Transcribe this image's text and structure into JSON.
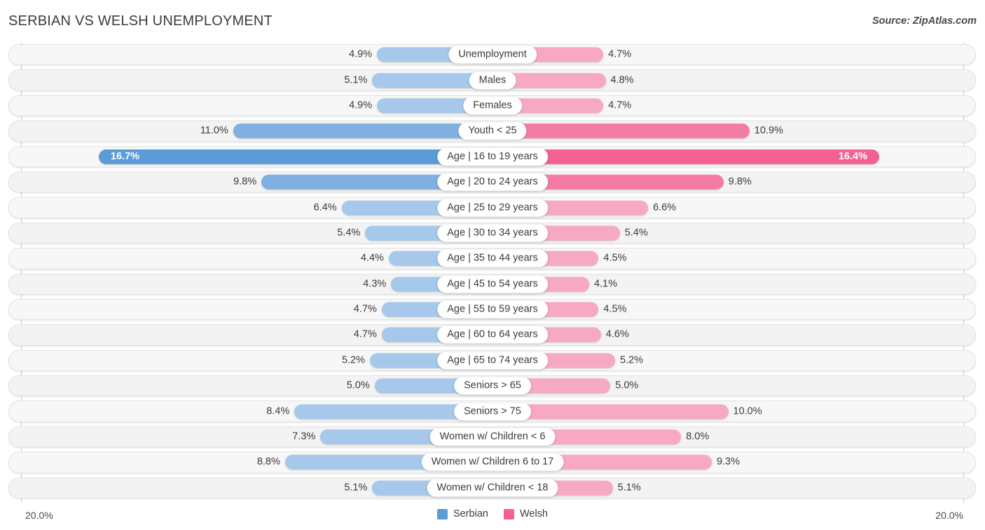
{
  "header": {
    "title": "SERBIAN VS WELSH UNEMPLOYMENT",
    "source": "Source: ZipAtlas.com"
  },
  "footer": {
    "axis_min_left": "20.0%",
    "axis_min_right": "20.0%",
    "legend": [
      {
        "label": "Serbian",
        "color": "#5b9bd8"
      },
      {
        "label": "Welsh",
        "color": "#f2618f"
      }
    ]
  },
  "colors": {
    "serbian_light": "#a6c8ea",
    "serbian_mid": "#7fb0e0",
    "serbian_dark": "#5b9bd8",
    "welsh_light": "#f7a8c4",
    "welsh_mid": "#f47ba6",
    "welsh_dark": "#f2618f",
    "track": "#f7f7f7",
    "axis": "#c9c9cd"
  },
  "chart_data": {
    "type": "bar",
    "orientation": "horizontal-diverging",
    "title": "SERBIAN VS WELSH UNEMPLOYMENT",
    "xlabel": "",
    "ylabel": "",
    "axis_max": 20.0,
    "axis_unit": "%",
    "grid": false,
    "legend_position": "bottom-center",
    "categories": [
      "Unemployment",
      "Males",
      "Females",
      "Youth < 25",
      "Age | 16 to 19 years",
      "Age | 20 to 24 years",
      "Age | 25 to 29 years",
      "Age | 30 to 34 years",
      "Age | 35 to 44 years",
      "Age | 45 to 54 years",
      "Age | 55 to 59 years",
      "Age | 60 to 64 years",
      "Age | 65 to 74 years",
      "Seniors > 65",
      "Seniors > 75",
      "Women w/ Children < 6",
      "Women w/ Children 6 to 17",
      "Women w/ Children < 18"
    ],
    "series": [
      {
        "name": "Serbian",
        "side": "left",
        "color": "#a6c8ea",
        "values": [
          4.9,
          5.1,
          4.9,
          11.0,
          16.7,
          9.8,
          6.4,
          5.4,
          4.4,
          4.3,
          4.7,
          4.7,
          5.2,
          5.0,
          8.4,
          7.3,
          8.8,
          5.1
        ],
        "labels": [
          "4.9%",
          "5.1%",
          "4.9%",
          "11.0%",
          "16.7%",
          "9.8%",
          "6.4%",
          "5.4%",
          "4.4%",
          "4.3%",
          "4.7%",
          "4.7%",
          "5.2%",
          "5.0%",
          "8.4%",
          "7.3%",
          "8.8%",
          "5.1%"
        ]
      },
      {
        "name": "Welsh",
        "side": "right",
        "color": "#f7a8c4",
        "values": [
          4.7,
          4.8,
          4.7,
          10.9,
          16.4,
          9.8,
          6.6,
          5.4,
          4.5,
          4.1,
          4.5,
          4.6,
          5.2,
          5.0,
          10.0,
          8.0,
          9.3,
          5.1
        ],
        "labels": [
          "4.7%",
          "4.8%",
          "4.7%",
          "10.9%",
          "16.4%",
          "9.8%",
          "6.6%",
          "5.4%",
          "4.5%",
          "4.1%",
          "4.5%",
          "4.6%",
          "5.2%",
          "5.0%",
          "10.0%",
          "8.0%",
          "9.3%",
          "5.1%"
        ]
      }
    ]
  }
}
